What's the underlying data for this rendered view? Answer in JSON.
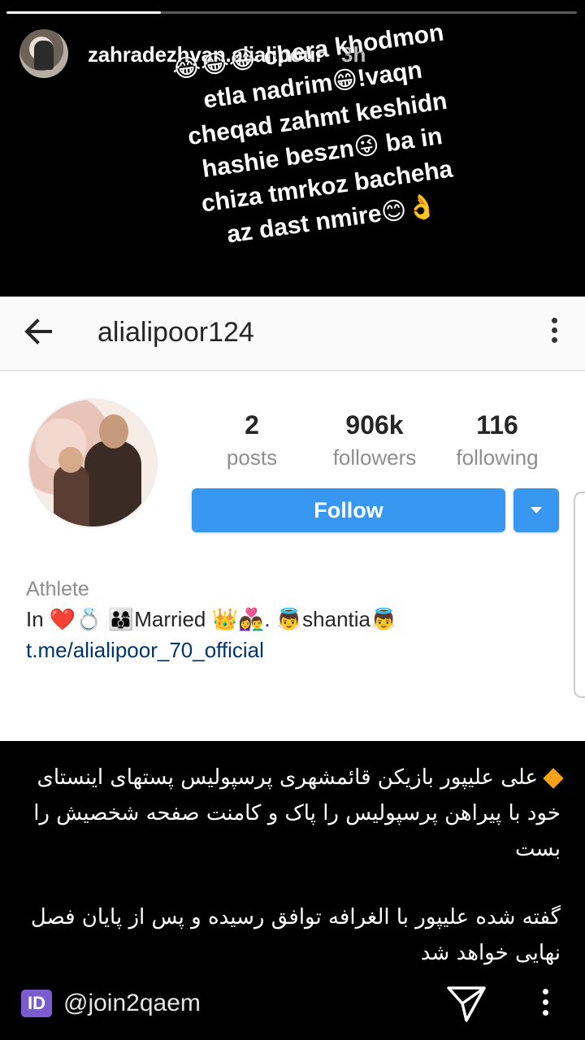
{
  "story": {
    "progress": 0.27,
    "username": "zahradezhvan.alialipour",
    "time": "3h",
    "caption_lines": [
      "😂😂😂 chera khodmon",
      "etla nadrim😁!vaqn",
      "cheqad zahmt keshidn",
      "hashie beszn😜 ba in",
      "chiza tmrkoz bacheha",
      "az dast nmire😊👌"
    ]
  },
  "profile": {
    "username": "alialipoor124",
    "stats": [
      {
        "value": "2",
        "label": "posts"
      },
      {
        "value": "906k",
        "label": "followers"
      },
      {
        "value": "116",
        "label": "following"
      }
    ],
    "follow_label": "Follow",
    "category": "Athlete",
    "bio": "In ❤️💍 👨‍👩‍👦Married 👑👩‍❤️‍👨. 👼shantia👼",
    "link": "t.me/alialipoor_70_official"
  },
  "news": {
    "paragraphs": [
      "علی علیپور بازیکن قائمشهری پرسپولیس پستهای اینستای خود با پیراهن پرسپولیس را پاک و کامنت صفحه شخصیش را بست",
      "گفته شده علیپور با الغرافه توافق رسیده و پس از پایان فصل نهایی خواهد شد"
    ]
  },
  "footer": {
    "badge": "ID",
    "handle": "@join2qaem"
  },
  "colors": {
    "accent": "#3897f0",
    "link": "#003569",
    "badge": "#7b5ccf",
    "diamond": "#f7a21b"
  }
}
